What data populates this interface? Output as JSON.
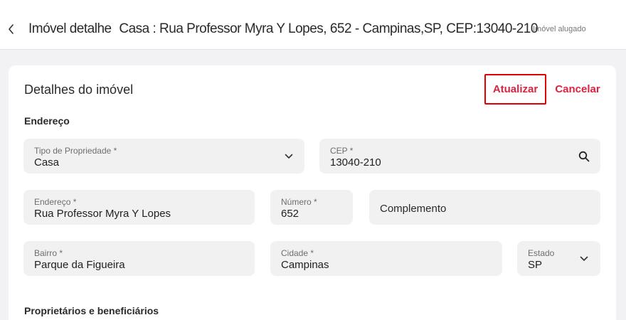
{
  "header": {
    "title_prefix": "Imóvel detalhe",
    "title_address": "Casa : Rua Professor Myra Y Lopes, 652 - Campinas,SP, CEP:13040-210",
    "status": "Imóvel alugado"
  },
  "card": {
    "title": "Detalhes do imóvel",
    "update_label": "Atualizar",
    "cancel_label": "Cancelar"
  },
  "sections": {
    "address": "Endereço",
    "owners": "Proprietários e beneficiários"
  },
  "fields": {
    "property_type": {
      "label": "Tipo de Propriedade *",
      "value": "Casa"
    },
    "cep": {
      "label": "CEP *",
      "value": "13040-210"
    },
    "street": {
      "label": "Endereço *",
      "value": "Rua Professor Myra Y Lopes"
    },
    "number": {
      "label": "Número *",
      "value": "652"
    },
    "complement": {
      "placeholder": "Complemento"
    },
    "neighborhood": {
      "label": "Bairro *",
      "value": "Parque da Figueira"
    },
    "city": {
      "label": "Cidade *",
      "value": "Campinas"
    },
    "state": {
      "label": "Estado",
      "value": "SP"
    }
  },
  "icons": {
    "back": "chevron-left-icon",
    "dropdown": "chevron-down-icon",
    "search": "search-icon"
  },
  "colors": {
    "accent": "#d9243f",
    "highlight_border": "#e00000",
    "field_bg": "#f1f1f1"
  }
}
